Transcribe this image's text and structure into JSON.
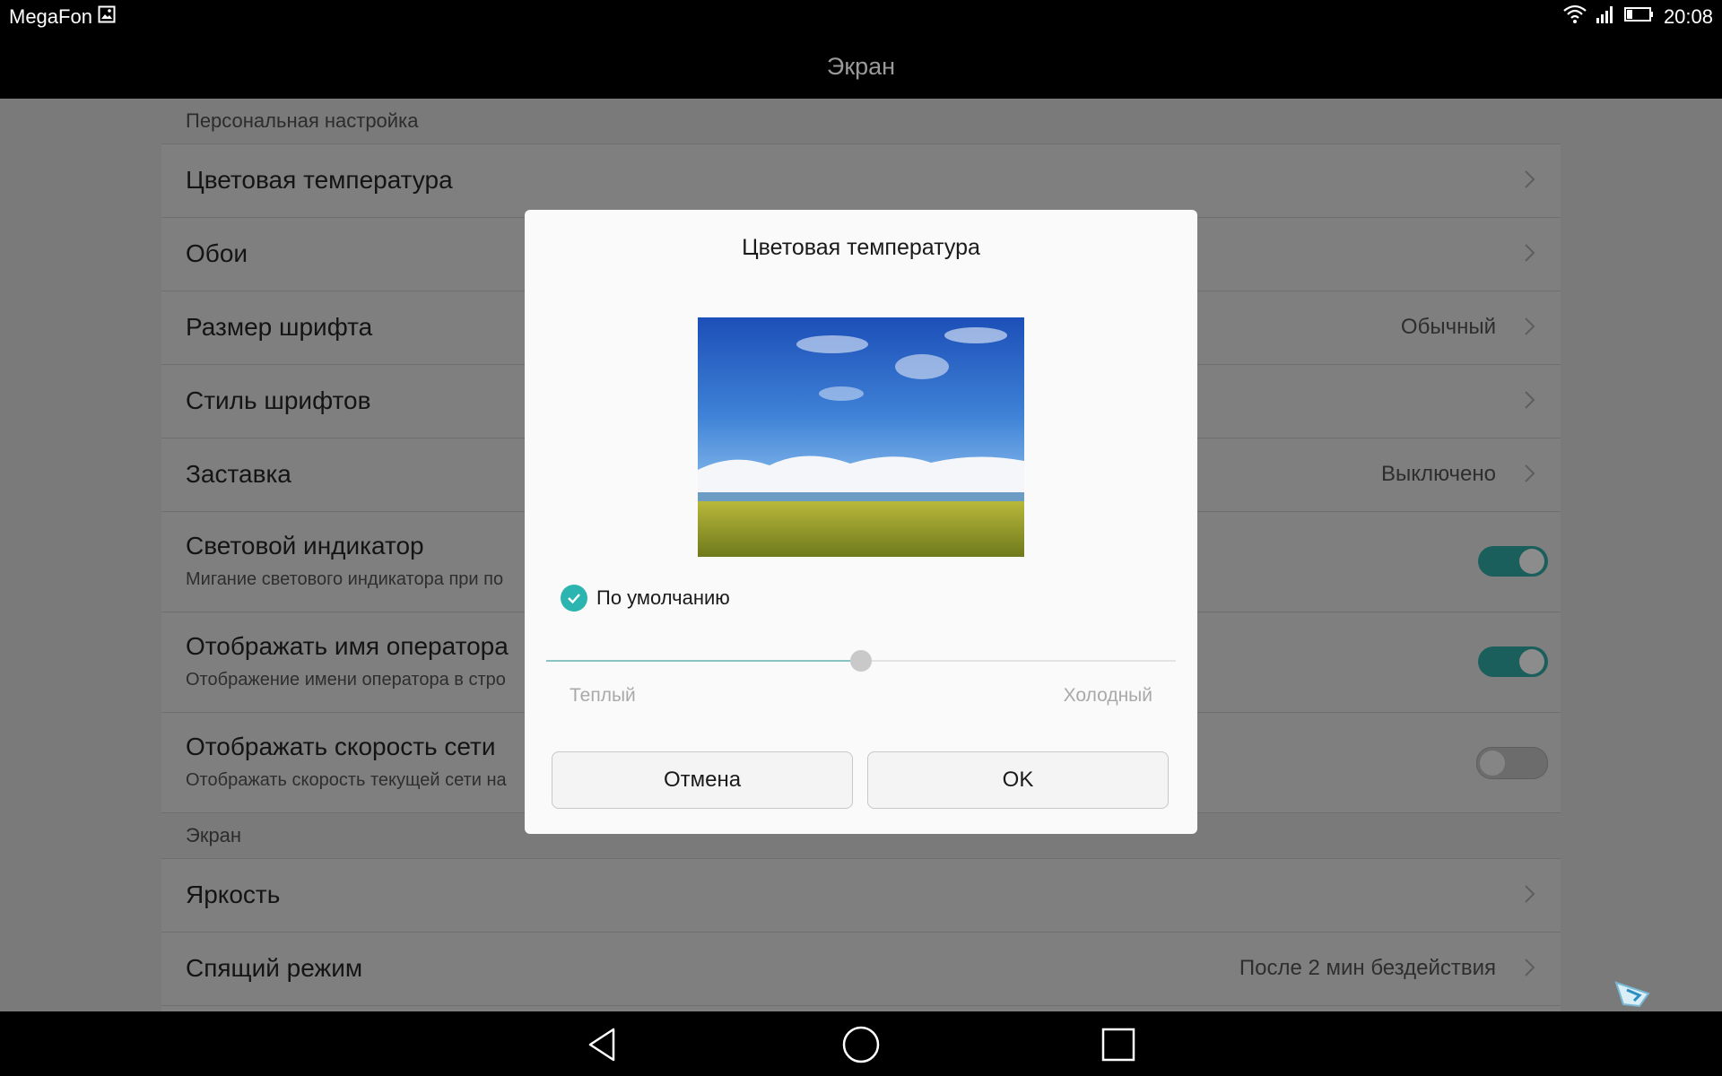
{
  "status_bar": {
    "carrier": "MegaFon",
    "time": "20:08"
  },
  "title_bar": {
    "title": "Экран"
  },
  "settings": {
    "section_personal": "Персональная настройка",
    "items": [
      {
        "label": "Цветовая температура"
      },
      {
        "label": "Обои"
      },
      {
        "label": "Размер шрифта",
        "value": "Обычный"
      },
      {
        "label": "Стиль шрифтов"
      },
      {
        "label": "Заставка",
        "value": "Выключено"
      },
      {
        "label": "Световой индикатор",
        "sub": "Мигание светового индикатора при по",
        "toggle": "on"
      },
      {
        "label": "Отображать имя оператора",
        "sub": "Отображение имени оператора в стро",
        "toggle": "on"
      },
      {
        "label": "Отображать скорость сети",
        "sub": "Отображать скорость текущей сети на",
        "toggle": "off"
      }
    ],
    "section_screen": "Экран",
    "screen_items": [
      {
        "label": "Яркость"
      },
      {
        "label": "Спящий режим",
        "value": "После 2 мин бездействия"
      }
    ]
  },
  "dialog": {
    "title": "Цветовая температура",
    "default_checkbox": {
      "label": "По умолчанию",
      "checked": true
    },
    "slider": {
      "value_percent": 50,
      "min_label": "Теплый",
      "max_label": "Холодный"
    },
    "cancel_label": "Отмена",
    "ok_label": "OK"
  },
  "colors": {
    "accent": "#2bb4b0",
    "toggle_on": "#1b5f5c"
  },
  "icons": [
    "picture-icon",
    "wifi-icon",
    "signal-icon",
    "battery-icon",
    "chevron-right-icon",
    "back-icon",
    "home-icon",
    "recents-icon",
    "check-icon"
  ]
}
